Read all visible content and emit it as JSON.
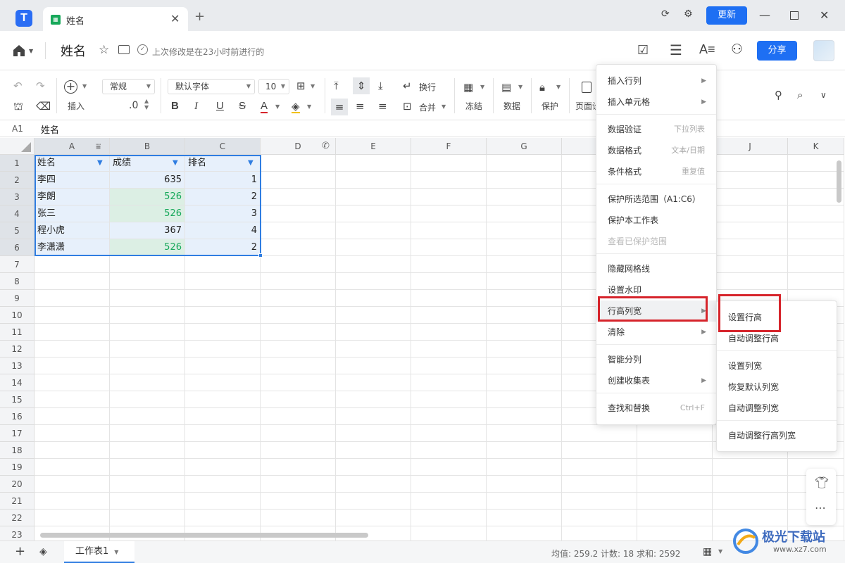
{
  "titlebar": {
    "tab_title": "姓名",
    "tab_add": "+",
    "tab_close": "✕",
    "update_label": "更新"
  },
  "docbar": {
    "title": "姓名",
    "save_status": "上次修改是在23小时前进行的",
    "share_label": "分享"
  },
  "toolbar": {
    "insert_label": "插入",
    "number_format": "常规",
    "decimal_label": ".0",
    "font_name": "默认字体",
    "font_size": "10",
    "wrap_label": "换行",
    "merge_label": "合并",
    "freeze_label": "冻结",
    "data_label": "数据",
    "protect_label": "保护",
    "page_label": "页面设"
  },
  "formula": {
    "cell_ref": "A1",
    "value": "姓名"
  },
  "grid": {
    "columns": [
      "A",
      "B",
      "C",
      "D",
      "E",
      "F",
      "G",
      "H",
      "I",
      "J",
      "K"
    ],
    "rows": [
      "1",
      "2",
      "3",
      "4",
      "5",
      "6",
      "7",
      "8",
      "9",
      "10",
      "11",
      "12",
      "13",
      "14",
      "15",
      "16",
      "17",
      "18",
      "19",
      "20",
      "21",
      "22",
      "23"
    ],
    "data": [
      [
        "姓名",
        "成绩",
        "排名"
      ],
      [
        "李四",
        "635",
        "1"
      ],
      [
        "李朗",
        "526",
        "2"
      ],
      [
        "张三",
        "526",
        "3"
      ],
      [
        "程小虎",
        "367",
        "4"
      ],
      [
        "李潇潇",
        "526",
        "2"
      ]
    ]
  },
  "bottombar": {
    "add": "+",
    "sheet_tab": "工作表1",
    "status": "均值: 259.2   计数: 18   求和: 2592"
  },
  "context_menu": {
    "items": [
      {
        "label": "插入行列",
        "hint": "",
        "submenu": true
      },
      {
        "label": "插入单元格",
        "hint": "",
        "submenu": true
      },
      {
        "label": "数据验证",
        "hint": "下拉列表"
      },
      {
        "label": "数据格式",
        "hint": "文本/日期"
      },
      {
        "label": "条件格式",
        "hint": "重复值"
      },
      {
        "label": "保护所选范围（A1:C6）",
        "hint": ""
      },
      {
        "label": "保护本工作表",
        "hint": ""
      },
      {
        "label": "查看已保护范围",
        "hint": "",
        "disabled": true
      },
      {
        "label": "隐藏网格线",
        "hint": ""
      },
      {
        "label": "设置水印",
        "hint": ""
      },
      {
        "label": "行高列宽",
        "hint": "",
        "submenu": true
      },
      {
        "label": "清除",
        "hint": "",
        "submenu": true
      },
      {
        "label": "智能分列",
        "hint": ""
      },
      {
        "label": "创建收集表",
        "hint": "",
        "submenu": true
      },
      {
        "label": "查找和替换",
        "hint": "Ctrl+F"
      }
    ]
  },
  "submenu": {
    "items": [
      "设置行高",
      "自动调整行高",
      "设置列宽",
      "恢复默认列宽",
      "自动调整列宽",
      "自动调整行高列宽"
    ]
  },
  "watermark": {
    "text": "极光下载站",
    "url": "www.xz7.com"
  },
  "colors": {
    "accent": "#1e6ff3",
    "selection": "#2f7de1",
    "green": "#17a85a",
    "highlight": "#d6242b"
  }
}
